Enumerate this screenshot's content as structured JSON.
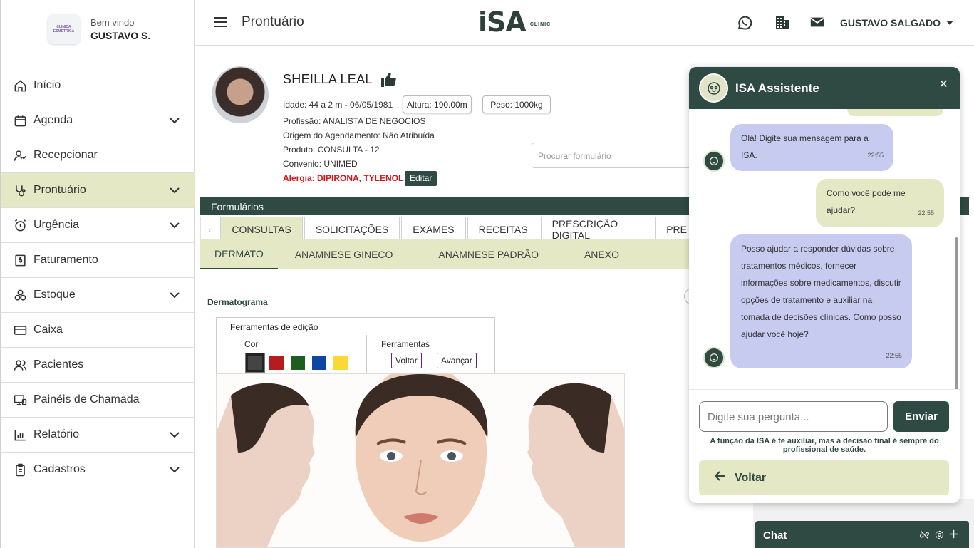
{
  "sidebar": {
    "welcome": "Bem vindo",
    "user_short": "GUSTAVO S.",
    "logo_text": "CLINICA ESMETRICA",
    "items": [
      {
        "label": "Início",
        "icon": "home-icon",
        "chevron": false,
        "active": false
      },
      {
        "label": "Agenda",
        "icon": "calendar-icon",
        "chevron": true,
        "active": false
      },
      {
        "label": "Recepcionar",
        "icon": "user-check-icon",
        "chevron": false,
        "active": false
      },
      {
        "label": "Prontuário",
        "icon": "stethoscope-icon",
        "chevron": true,
        "active": true
      },
      {
        "label": "Urgência",
        "icon": "alarm-icon",
        "chevron": true,
        "active": false
      },
      {
        "label": "Faturamento",
        "icon": "dollar-icon",
        "chevron": false,
        "active": false
      },
      {
        "label": "Estoque",
        "icon": "boxes-icon",
        "chevron": true,
        "active": false
      },
      {
        "label": "Caixa",
        "icon": "card-icon",
        "chevron": false,
        "active": false
      },
      {
        "label": "Pacientes",
        "icon": "users-icon",
        "chevron": false,
        "active": false
      },
      {
        "label": "Painéis de Chamada",
        "icon": "monitor-icon",
        "chevron": false,
        "active": false
      },
      {
        "label": "Relatório",
        "icon": "bar-chart-icon",
        "chevron": true,
        "active": false
      },
      {
        "label": "Cadastros",
        "icon": "clipboard-icon",
        "chevron": true,
        "active": false
      }
    ]
  },
  "header": {
    "title": "Prontuário",
    "brand": "iSA",
    "brand_sub": "CLINIC",
    "user": "GUSTAVO SALGADO"
  },
  "patient": {
    "name": "SHEILLA LEAL",
    "age": "Idade: 44 a 2 m - 06/05/1981",
    "height": "Altura: 190.00m",
    "weight": "Peso: 1000kg",
    "profession": "Profissão: ANALISTA DE NEGOCIOS",
    "origin": "Origem do Agendamento:  Não Atribuída",
    "product": "Produto: CONSULTA - 12",
    "insurance": "Convenio: UNIMED",
    "allergy": "Alergia: DIPIRONA, TYLENOL",
    "edit_label": "Editar",
    "search_placeholder": "Procurar formulário"
  },
  "forms": {
    "bar_label": "Formulários",
    "tabs": [
      "CONSULTAS",
      "SOLICITAÇÕES",
      "EXAMES",
      "RECEITAS",
      "PRESCRIÇÃO DIGITAL",
      "PRE"
    ],
    "subtabs": [
      "DERMATO",
      "ANAMNESE GINECO",
      "ANAMNESE PADRÃO",
      "ANEXO"
    ]
  },
  "dermato": {
    "title": "Dermatograma",
    "tools_title": "Ferramentas de edição",
    "color_label": "Cor",
    "tools_label": "Ferramentas",
    "undo": "Voltar",
    "redo": "Avançar",
    "colors": [
      "#444444",
      "#b71c1c",
      "#1b5e20",
      "#0d47a1",
      "#fdd835"
    ]
  },
  "assistant": {
    "title": "ISA Assistente",
    "messages": [
      {
        "from": "bot",
        "text": "Olá! Digite sua mensagem para a ISA.",
        "time": "22:55"
      },
      {
        "from": "user",
        "text": "Como você pode me ajudar?",
        "time": "22:55"
      },
      {
        "from": "bot",
        "lines": [
          "Posso ajudar a responder dúvidas sobre",
          "tratamentos médicos, fornecer",
          "informações sobre medicamentos, discutir",
          "opções de tratamento e auxiliar na",
          "tomada de decisões clínicas. Como posso",
          "ajudar você hoje?"
        ],
        "time": "22:55"
      }
    ],
    "input_placeholder": "Digite sua pergunta...",
    "send_label": "Enviar",
    "disclaimer_1": "A função da ISA é te auxiliar, mas a decisão final é sempre do",
    "disclaimer_2": "profissional de saúde.",
    "back_label": "Voltar"
  },
  "chat": {
    "label": "Chat"
  },
  "colors": {
    "primary": "#2e4a42",
    "accent_light": "#e5e8c5",
    "bot_bubble": "#c8cbf0",
    "allergy": "#d4161c"
  }
}
